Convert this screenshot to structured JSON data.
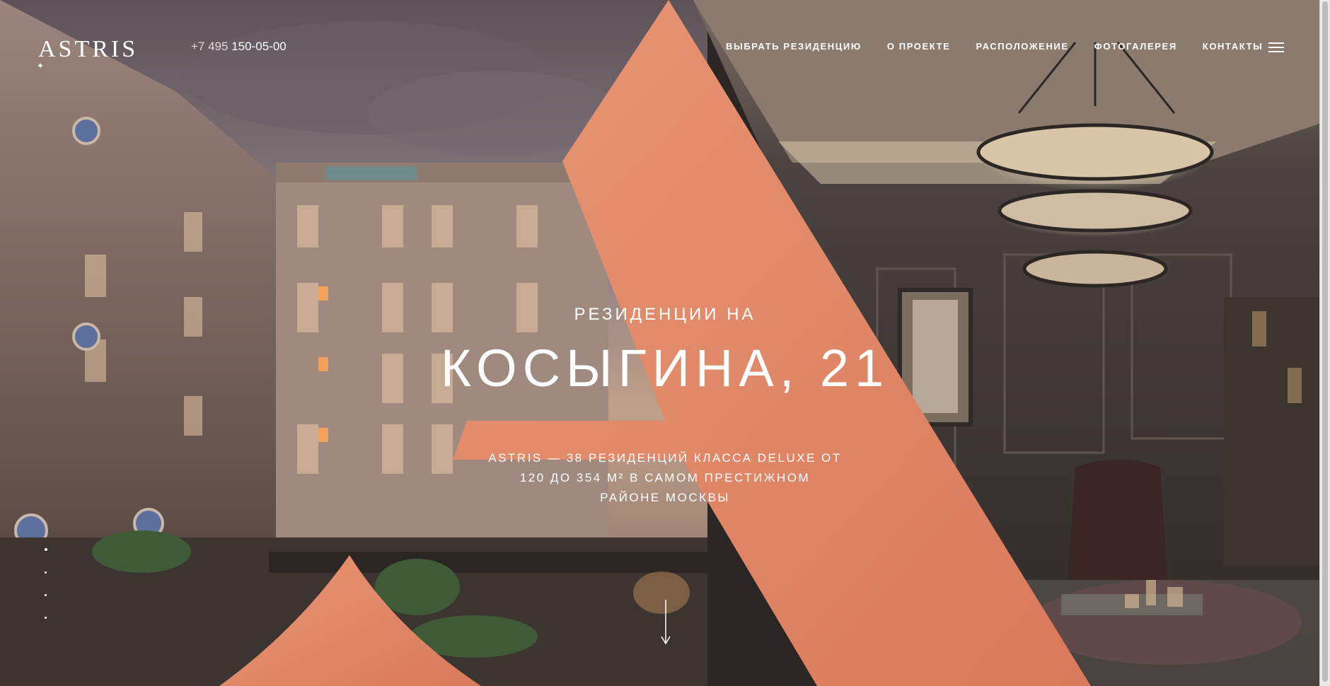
{
  "brand": {
    "logo": "ASTRIS"
  },
  "header": {
    "phone_prefix": "+7 495",
    "phone_number": "150-05-00",
    "nav": [
      "ВЫБРАТЬ РЕЗИДЕНЦИЮ",
      "О ПРОЕКТЕ",
      "РАСПОЛОЖЕНИЕ",
      "ФОТОГАЛЕРЕЯ",
      "КОНТАКТЫ"
    ],
    "menu_icon": "hamburger-icon"
  },
  "hero": {
    "subtitle": "РЕЗИДЕНЦИИ НА",
    "title": "КОСЫГИНА, 21",
    "description": "ASTRIS — 38 РЕЗИДЕНЦИЙ КЛАССА DELUXE ОТ 120 ДО 354 М² В САМОМ ПРЕСТИЖНОМ РАЙОНЕ МОСКВЫ"
  },
  "slider": {
    "dots": 4,
    "active": 1
  },
  "colors": {
    "accent": "#e58a66",
    "accent_dark": "#d9785a",
    "text": "#ffffff"
  },
  "icons": [
    "hamburger-icon",
    "arrow-down-icon"
  ]
}
